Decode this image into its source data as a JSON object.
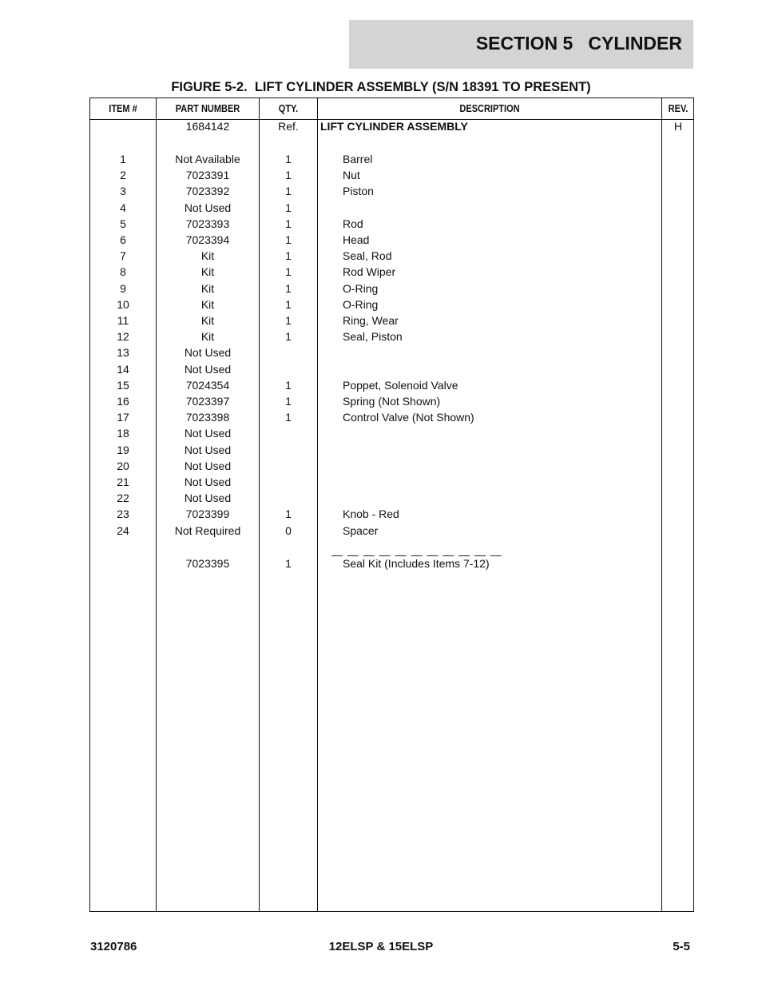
{
  "header": {
    "section_title": "SECTION 5   CYLINDER"
  },
  "figure": {
    "title": "FIGURE 5-2.  LIFT CYLINDER ASSEMBLY (S/N 18391 TO PRESENT)"
  },
  "table": {
    "columns": {
      "item": "ITEM #",
      "part_number": "PART NUMBER",
      "qty": "QTY.",
      "description": "DESCRIPTION",
      "rev": "REV."
    },
    "assembly": {
      "item": "",
      "part_number": "1684142",
      "qty": "Ref.",
      "description": "LIFT CYLINDER ASSEMBLY",
      "rev": "H"
    },
    "rows": [
      {
        "item": "1",
        "part_number": "Not Available",
        "qty": "1",
        "description": "Barrel"
      },
      {
        "item": "2",
        "part_number": "7023391",
        "qty": "1",
        "description": "Nut"
      },
      {
        "item": "3",
        "part_number": "7023392",
        "qty": "1",
        "description": "Piston"
      },
      {
        "item": "4",
        "part_number": "Not Used",
        "qty": "1",
        "description": ""
      },
      {
        "item": "5",
        "part_number": "7023393",
        "qty": "1",
        "description": "Rod"
      },
      {
        "item": "6",
        "part_number": "7023394",
        "qty": "1",
        "description": "Head"
      },
      {
        "item": "7",
        "part_number": "Kit",
        "qty": "1",
        "description": "Seal, Rod"
      },
      {
        "item": "8",
        "part_number": "Kit",
        "qty": "1",
        "description": "Rod Wiper"
      },
      {
        "item": "9",
        "part_number": "Kit",
        "qty": "1",
        "description": "O-Ring"
      },
      {
        "item": "10",
        "part_number": "Kit",
        "qty": "1",
        "description": "O-Ring"
      },
      {
        "item": "11",
        "part_number": "Kit",
        "qty": "1",
        "description": "Ring, Wear"
      },
      {
        "item": "12",
        "part_number": "Kit",
        "qty": "1",
        "description": "Seal, Piston"
      },
      {
        "item": "13",
        "part_number": "Not Used",
        "qty": "",
        "description": ""
      },
      {
        "item": "14",
        "part_number": "Not Used",
        "qty": "",
        "description": ""
      },
      {
        "item": "15",
        "part_number": "7024354",
        "qty": "1",
        "description": "Poppet, Solenoid Valve"
      },
      {
        "item": "16",
        "part_number": "7023397",
        "qty": "1",
        "description": "Spring (Not Shown)"
      },
      {
        "item": "17",
        "part_number": "7023398",
        "qty": "1",
        "description": "Control Valve (Not Shown)"
      },
      {
        "item": "18",
        "part_number": "Not Used",
        "qty": "",
        "description": ""
      },
      {
        "item": "19",
        "part_number": "Not Used",
        "qty": "",
        "description": ""
      },
      {
        "item": "20",
        "part_number": "Not Used",
        "qty": "",
        "description": ""
      },
      {
        "item": "21",
        "part_number": "Not Used",
        "qty": "",
        "description": ""
      },
      {
        "item": "22",
        "part_number": "Not Used",
        "qty": "",
        "description": ""
      },
      {
        "item": "23",
        "part_number": "7023399",
        "qty": "1",
        "description": "Knob - Red"
      },
      {
        "item": "24",
        "part_number": "Not Required",
        "qty": "0",
        "description": "Spacer"
      }
    ],
    "separator": "— — — — — — — — — — —",
    "kit_row": {
      "item": "",
      "part_number": "7023395",
      "qty": "1",
      "description": "Seal Kit (Includes Items 7-12)"
    }
  },
  "footer": {
    "doc_number": "3120786",
    "models": "12ELSP & 15ELSP",
    "page": "5-5"
  }
}
